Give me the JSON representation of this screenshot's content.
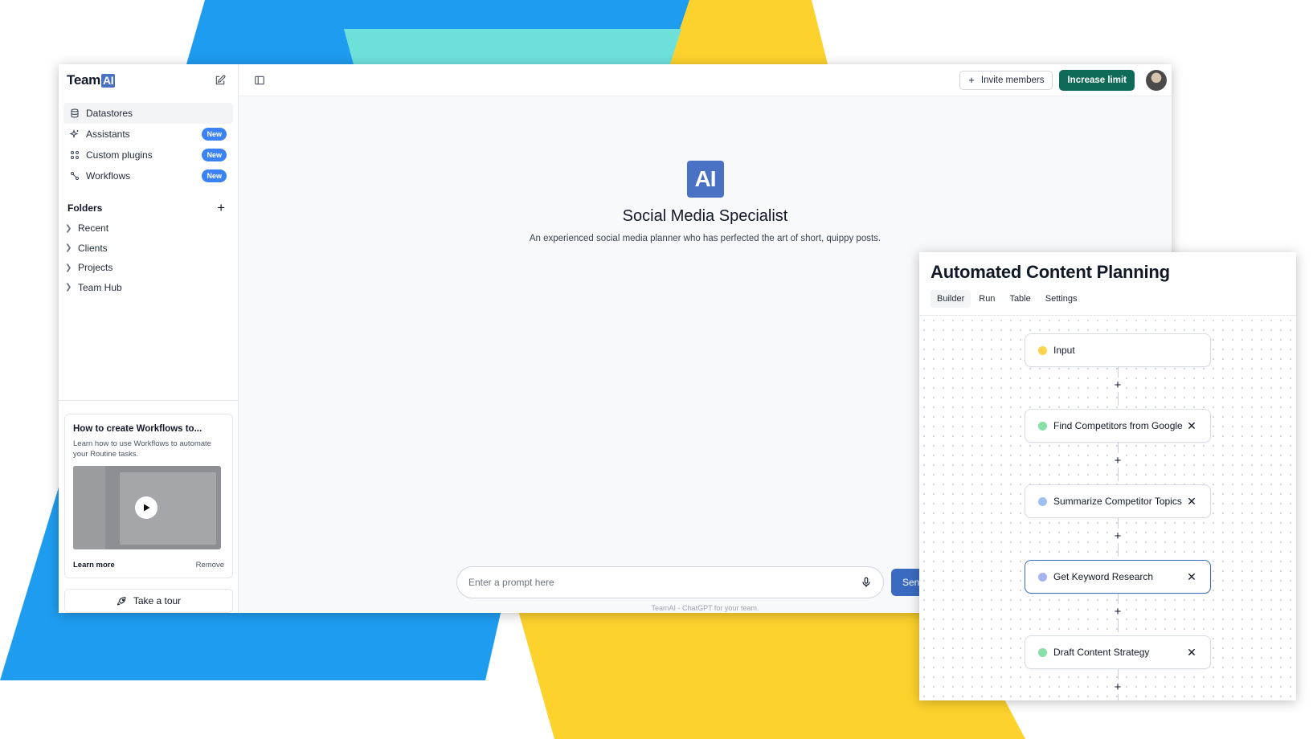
{
  "colors": {
    "blue_shape": "#1e9cf0",
    "teal_shape": "#6ee0da",
    "yellow_shape": "#fdd22d",
    "brand_blue": "#4a72c4",
    "increase_green": "#0f6b57",
    "badge_blue": "#3b82f6"
  },
  "sidebar": {
    "logo_text": "Team",
    "logo_badge": "AI",
    "nav": [
      {
        "label": "Datastores",
        "icon": "database-icon"
      },
      {
        "label": "Assistants",
        "icon": "sparkles-icon",
        "badge": "New"
      },
      {
        "label": "Custom plugins",
        "icon": "grid-icon",
        "badge": "New"
      },
      {
        "label": "Workflows",
        "icon": "workflow-icon",
        "badge": "New"
      }
    ],
    "folders_label": "Folders",
    "folders": [
      "Recent",
      "Clients",
      "Projects",
      "Team Hub"
    ],
    "card": {
      "title": "How to create Workflows to...",
      "desc": "Learn how to use Workflows to automate your Routine tasks.",
      "learn_more": "Learn more",
      "remove": "Remove"
    },
    "tour_label": "Take a tour"
  },
  "topbar": {
    "invite_label": "Invite members",
    "increase_label": "Increase limit"
  },
  "assistant": {
    "logo": "AI",
    "title": "Social Media Specialist",
    "description": "An experienced social media planner who has perfected the art of short, quippy posts."
  },
  "prompt": {
    "placeholder": "Enter a prompt here",
    "send_label": "Send",
    "footer": "TeamAI - ChatGPT for your team."
  },
  "workflow": {
    "title": "Automated Content Planning",
    "tabs": [
      "Builder",
      "Run",
      "Table",
      "Settings"
    ],
    "active_tab": "Builder",
    "nodes": [
      {
        "label": "Input",
        "dot": "#fcd34d",
        "removable": false
      },
      {
        "label": "Find Competitors from Google",
        "dot": "#86e0a8",
        "removable": true
      },
      {
        "label": "Summarize Competitor Topics",
        "dot": "#9ec0f2",
        "removable": true
      },
      {
        "label": "Get Keyword Research",
        "dot": "#a5b4f0",
        "removable": true,
        "selected": true
      },
      {
        "label": "Draft Content Strategy",
        "dot": "#86e0a8",
        "removable": true
      }
    ]
  }
}
